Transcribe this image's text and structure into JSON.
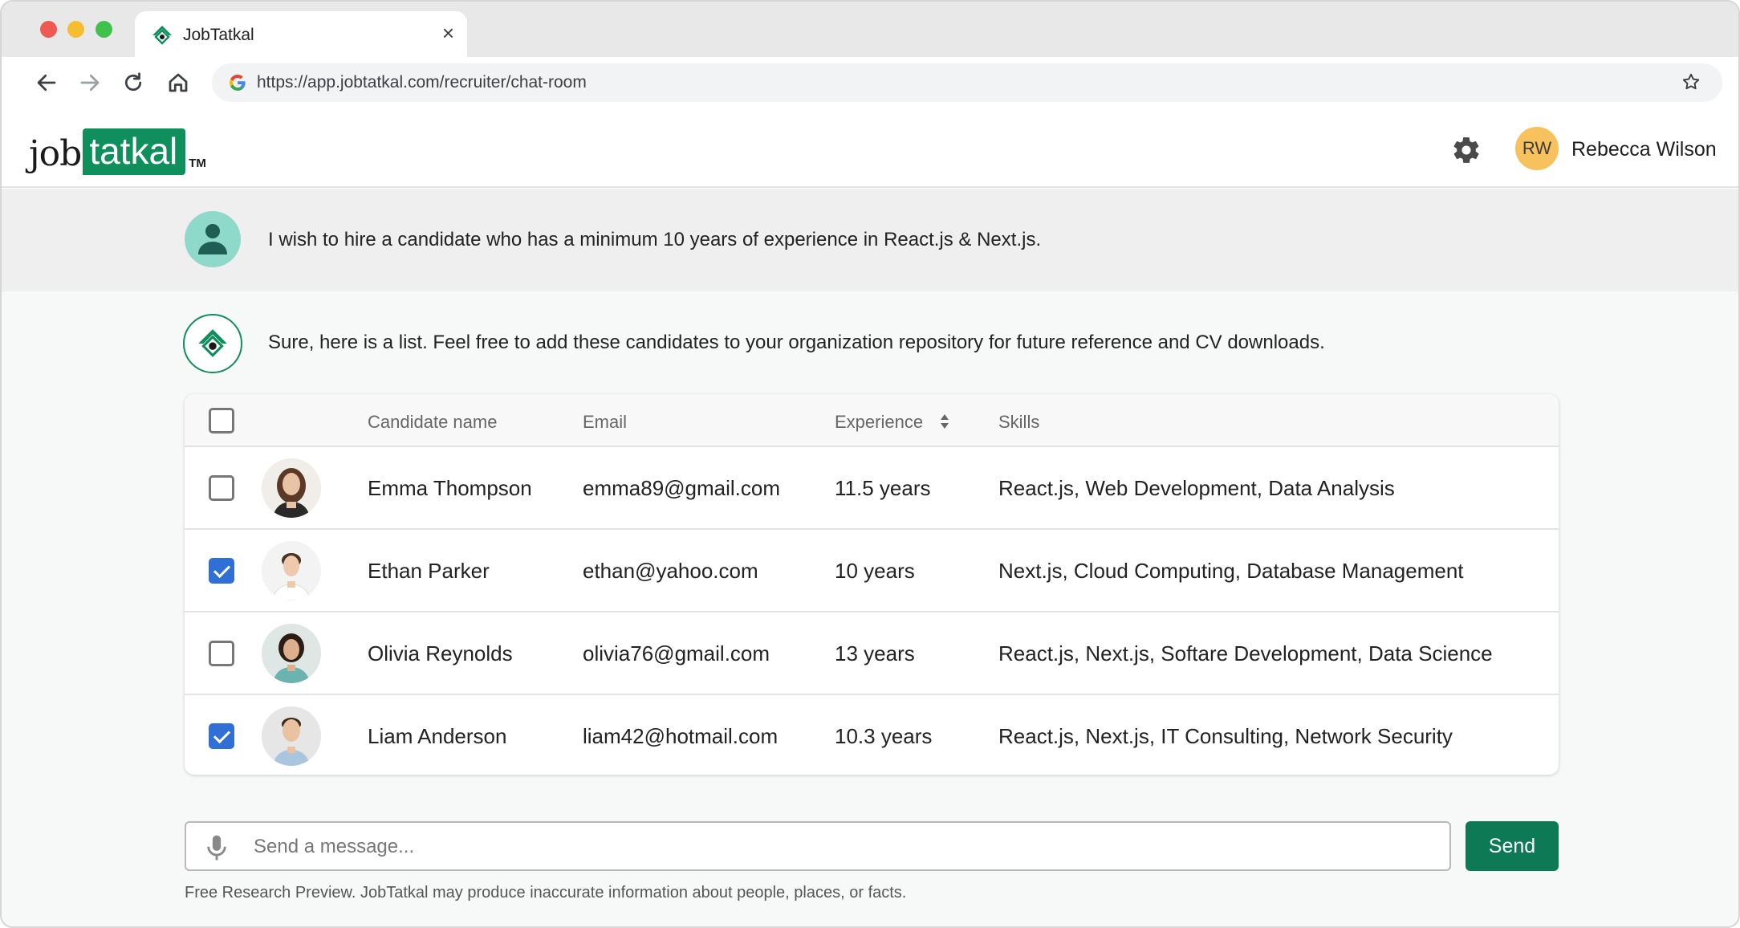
{
  "browser": {
    "tab_title": "JobTatkal",
    "tab_close": "×",
    "url": "https://app.jobtatkal.com/recruiter/chat-room"
  },
  "header": {
    "logo": {
      "part1": "job",
      "part2": "tatkal",
      "tm": "TM"
    },
    "user_initials": "RW",
    "user_name": "Rebecca Wilson"
  },
  "chat": {
    "user_message": "I wish to hire a candidate who has a minimum 10 years of experience in React.js & Next.js.",
    "bot_message": "Sure, here is a list. Feel free to add these candidates to your organization repository for future reference and CV downloads."
  },
  "table": {
    "columns": {
      "name": "Candidate name",
      "email": "Email",
      "experience": "Experience",
      "skills": "Skills"
    },
    "rows": [
      {
        "name": "Emma Thompson",
        "email": "emma89@gmail.com",
        "experience": "11.5 years",
        "skills": "React.js, Web Development, Data Analysis",
        "checked": false
      },
      {
        "name": "Ethan Parker",
        "email": "ethan@yahoo.com",
        "experience": "10 years",
        "skills": "Next.js, Cloud Computing, Database Management",
        "checked": true
      },
      {
        "name": "Olivia Reynolds",
        "email": "olivia76@gmail.com",
        "experience": "13 years",
        "skills": "React.js, Next.js, Softare Development, Data Science",
        "checked": false
      },
      {
        "name": "Liam Anderson",
        "email": "liam42@hotmail.com",
        "experience": "10.3 years",
        "skills": "React.js, Next.js, IT Consulting, Network Security",
        "checked": true
      }
    ]
  },
  "composer": {
    "placeholder": "Send a message...",
    "send_label": "Send",
    "disclaimer": "Free Research Preview. JobTatkal may produce inaccurate information about people, places, or facts."
  },
  "colors": {
    "brand_green": "#0f8f5c",
    "send_green": "#0d7a55",
    "checkbox_blue": "#2f6fd6",
    "avatar_yellow": "#f7c15d"
  }
}
